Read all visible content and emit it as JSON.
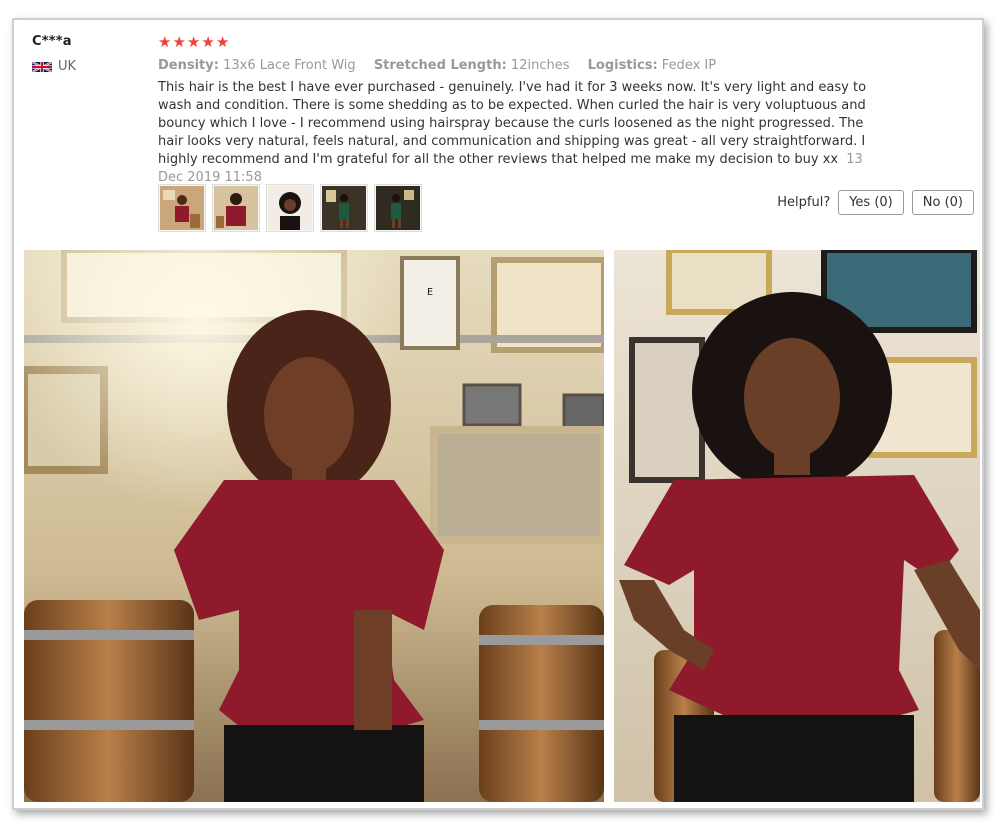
{
  "review": {
    "username": "C***a",
    "country": "UK",
    "rating": 5,
    "meta": {
      "density_label": "Density:",
      "density_value": "13x6 Lace Front Wig",
      "length_label": "Stretched Length:",
      "length_value": "12inches",
      "logistics_label": "Logistics:",
      "logistics_value": "Fedex IP"
    },
    "text": "This hair is the best I have ever purchased - genuinely. I've had it for 3 weeks now. It's very light and easy to wash and condition. There is some shedding as to be expected. When curled the hair is very voluptuous and bouncy which I love - I recommend using hairspray because the curls loosened as the night progressed. The hair looks very natural, feels natural, and communication and shipping was great - all very straightforward. I highly recommend and I'm grateful for all the other reviews that helped me make my decision to buy xx",
    "date": "13 Dec 2019 11:58"
  },
  "helpful": {
    "label": "Helpful?",
    "yes_label": "Yes (0)",
    "no_label": "No (0)"
  },
  "icons": {
    "star": "star-icon",
    "flag": "uk-flag-icon"
  },
  "colors": {
    "star": "#f0403c",
    "muted_text": "#999999",
    "body_text": "#333333",
    "blouse": "#8e1a2b"
  }
}
